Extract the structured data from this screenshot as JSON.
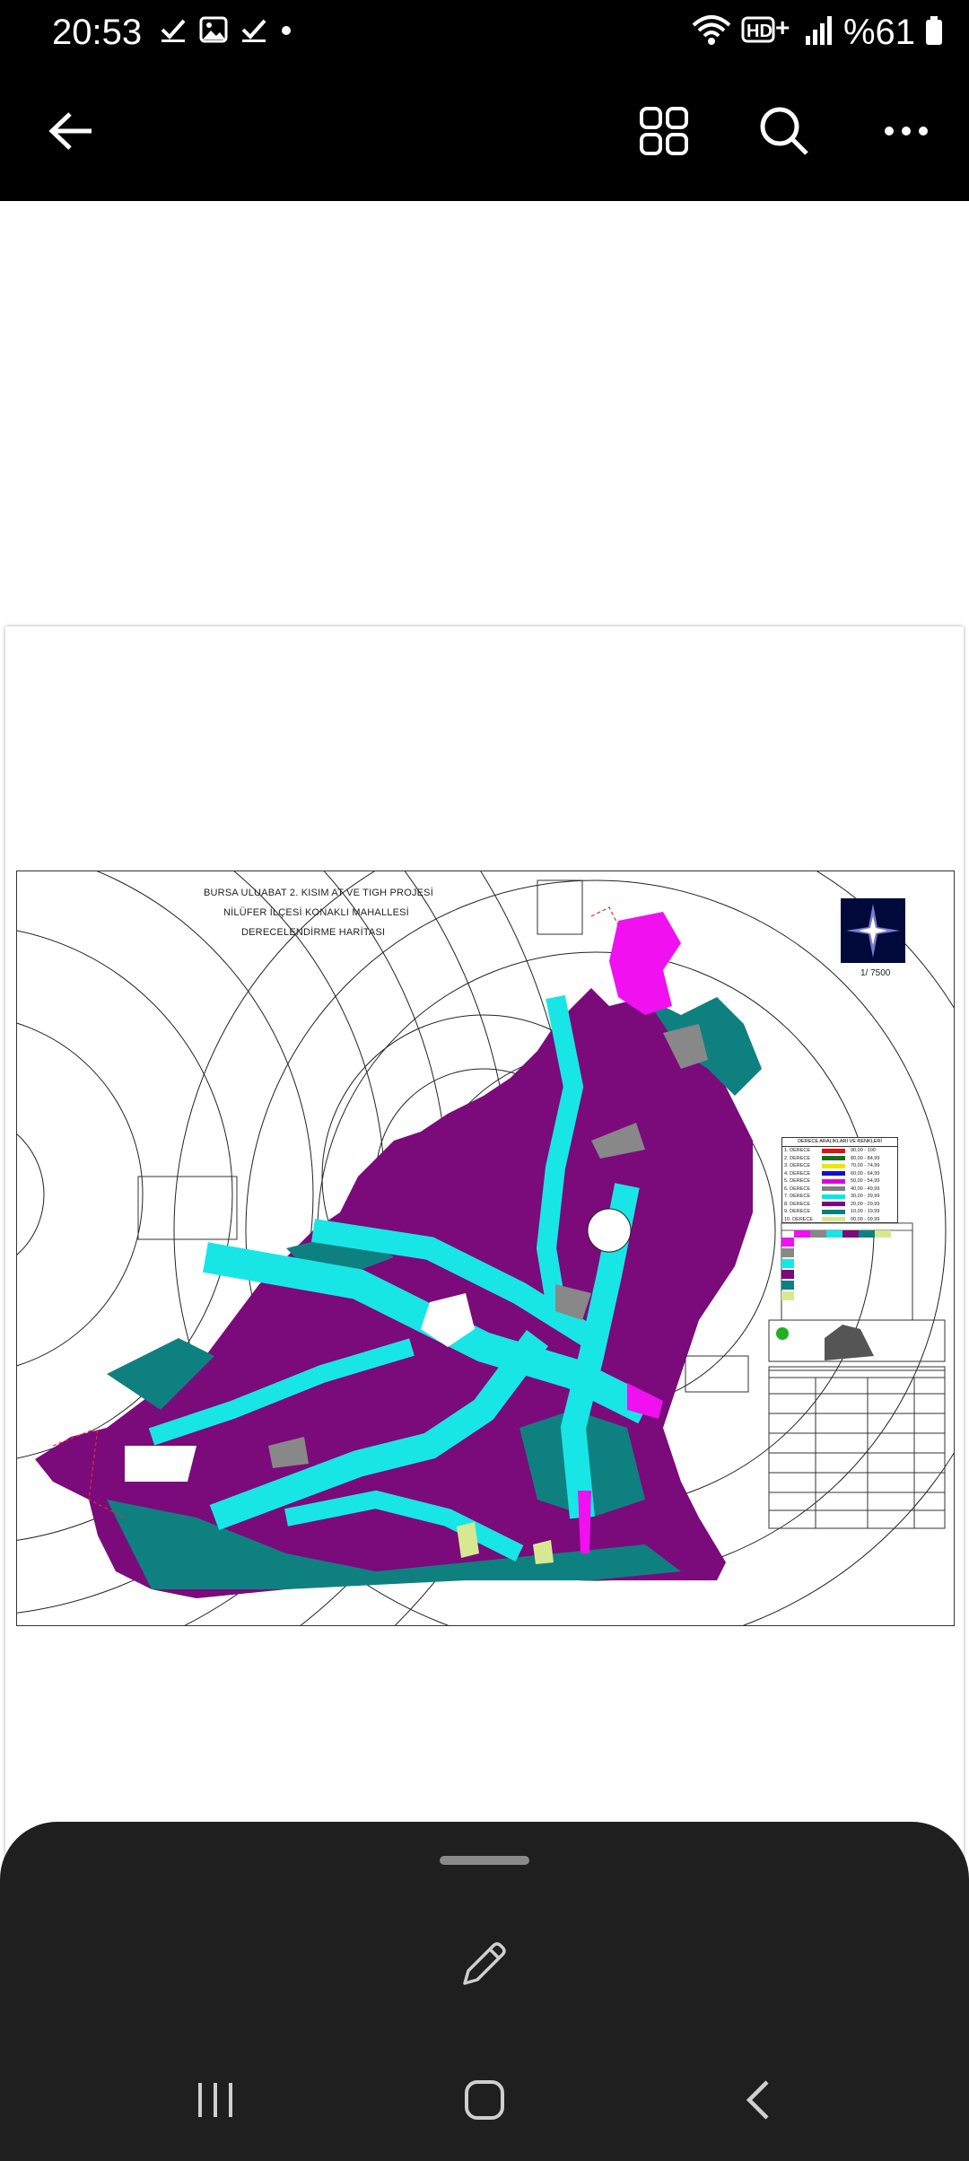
{
  "status_bar": {
    "time": "20:53",
    "icons_left": [
      "check-icon",
      "image-icon",
      "check-icon",
      "dot-icon"
    ],
    "icons_right": [
      "wifi-icon",
      "hd-plus-icon",
      "signal-icon"
    ],
    "battery_text": "%61"
  },
  "app_bar": {
    "back_icon": "arrow-left-icon",
    "grid_icon": "grid-icon",
    "search_icon": "search-icon",
    "more_icon": "more-icon"
  },
  "map": {
    "title_line1": "BURSA ULUABAT 2. KISIM AT VE TIGH PROJESİ",
    "title_line2": "NİLÜFER İLÇESİ KONAKLI MAHALLESİ",
    "title_line3": "DERECELENDİRME HARİTASI",
    "scale": "1/ 7500",
    "legend_title": "DERECE ARALIKLARI VE RENKLERİ",
    "legend": [
      {
        "label": "1. DERECE",
        "color": "#e01010",
        "range": "90,00 - 100"
      },
      {
        "label": "2. DERECE",
        "color": "#1a6b1a",
        "range": "80,00 - 84,99"
      },
      {
        "label": "3. DERECE",
        "color": "#e8e800",
        "range": "70,00 - 74,99"
      },
      {
        "label": "4. DERECE",
        "color": "#1010d0",
        "range": "60,00 - 64,99"
      },
      {
        "label": "5. DERECE",
        "color": "#e000e0",
        "range": "50,00 - 54,99"
      },
      {
        "label": "6. DERECE",
        "color": "#808080",
        "range": "40,00 - 49,99"
      },
      {
        "label": "7. DERECE",
        "color": "#00e8e8",
        "range": "30,00 - 39,99"
      },
      {
        "label": "8. DERECE",
        "color": "#800080",
        "range": "20,00 - 29,99"
      },
      {
        "label": "9. DERECE",
        "color": "#008080",
        "range": "10,00 - 19,99"
      },
      {
        "label": "10. DERECE",
        "color": "#d8e890",
        "range": "00,00 - 09,99"
      }
    ]
  },
  "bottom_sheet": {
    "edit_icon": "pencil-icon"
  },
  "nav_bar": {
    "recents_icon": "recents-icon",
    "home_icon": "home-icon",
    "back_icon": "back-chevron-icon"
  }
}
